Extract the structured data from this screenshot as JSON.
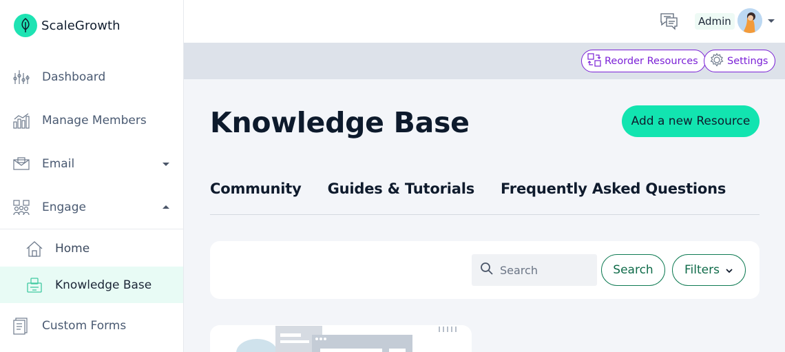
{
  "brand": {
    "name": "ScaleGrowth",
    "accent": "#1ee3b3"
  },
  "sidebar": {
    "items": [
      {
        "label": "Dashboard",
        "icon": "dashboard-icon"
      },
      {
        "label": "Manage Members",
        "icon": "members-chart-icon"
      },
      {
        "label": "Email",
        "icon": "email-icon",
        "expanded": false
      },
      {
        "label": "Engage",
        "icon": "engage-icon",
        "expanded": true
      },
      {
        "label": "Custom Forms",
        "icon": "forms-icon"
      }
    ],
    "engage_children": [
      {
        "label": "Home",
        "icon": "home-icon"
      },
      {
        "label": "Knowledge Base",
        "icon": "knowledge-base-icon",
        "active": true
      }
    ]
  },
  "topbar": {
    "user_label": "Admin"
  },
  "subheader": {
    "reorder_label": "Reorder Resources",
    "settings_label": "Settings",
    "accent": "#7a1fd6"
  },
  "main": {
    "title": "Knowledge Base",
    "add_button": "Add a new Resource",
    "tabs": [
      {
        "label": "Community"
      },
      {
        "label": "Guides & Tutorials"
      },
      {
        "label": "Frequently Asked Questions"
      }
    ],
    "search": {
      "placeholder": "Search",
      "button": "Search",
      "filters": "Filters"
    }
  }
}
